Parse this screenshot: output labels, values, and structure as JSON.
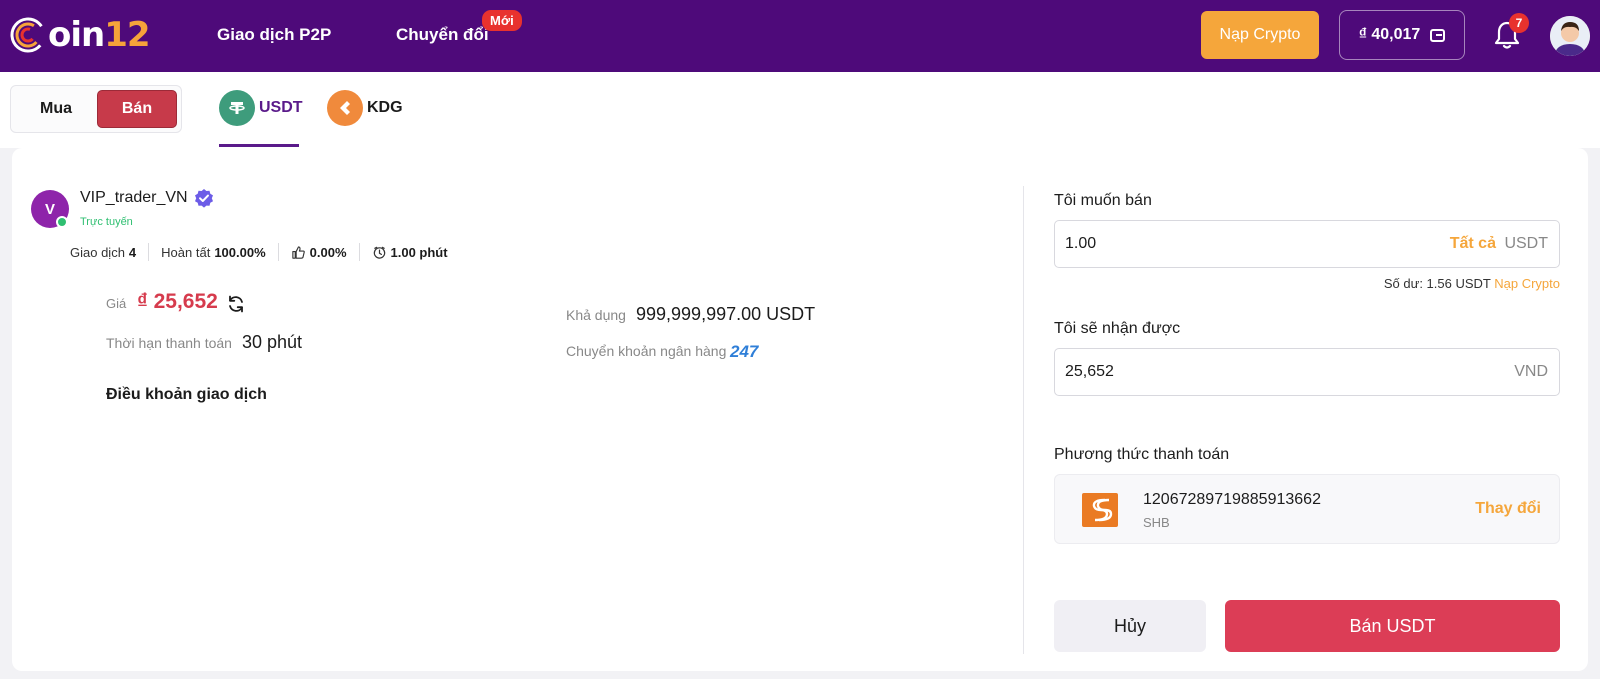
{
  "brand": {
    "logo_white": "C",
    "logo_mid": "oin",
    "logo_num": "12",
    "accent": "#f5a63b",
    "header_bg": "#4e0a7a"
  },
  "nav": {
    "p2p": "Giao dịch P2P",
    "convert": "Chuyển đổi",
    "new_badge": "Mới"
  },
  "header": {
    "deposit_button": "Nạp Crypto",
    "balance": "₫ 40,017",
    "notification_count": "7"
  },
  "mode": {
    "buy": "Mua",
    "sell": "Bán",
    "selected": "Bán"
  },
  "coins": [
    {
      "symbol": "USDT",
      "icon": "tether-icon"
    },
    {
      "symbol": "KDG",
      "icon": "kdg-icon"
    }
  ],
  "trader": {
    "initial": "V",
    "name": "VIP_trader_VN",
    "status": "Trực tuyến",
    "trades_label": "Giao dịch",
    "trades_value": "4",
    "completion_label": "Hoàn tất",
    "completion_value": "100.00%",
    "rating_value": "0.00%",
    "time_value": "1.00 phút"
  },
  "offer": {
    "price_label": "Giá",
    "price_value": "₫ 25,652",
    "payment_time_label": "Thời hạn thanh toán",
    "payment_time_value": "30 phút",
    "available_label": "Khả dụng",
    "available_value": "999,999,997.00 USDT",
    "transfer_label": "Chuyển khoản ngân hàng",
    "transfer_badge": "247",
    "terms_title": "Điều khoản giao dịch"
  },
  "form": {
    "sell_label": "Tôi muốn bán",
    "sell_amount": "1.00",
    "all_label": "Tất cả",
    "sell_unit": "USDT",
    "balance_text": "Số dư: 1.56 USDT",
    "deposit_link": "Nạp Crypto",
    "receive_label": "Tôi sẽ nhận được",
    "receive_amount": "25,652",
    "receive_unit": "VND",
    "payment_label": "Phương thức thanh toán",
    "account_number": "12067289719885913662",
    "bank_name": "SHB",
    "change_label": "Thay đổi",
    "cancel_button": "Hủy",
    "submit_button": "Bán USDT"
  }
}
